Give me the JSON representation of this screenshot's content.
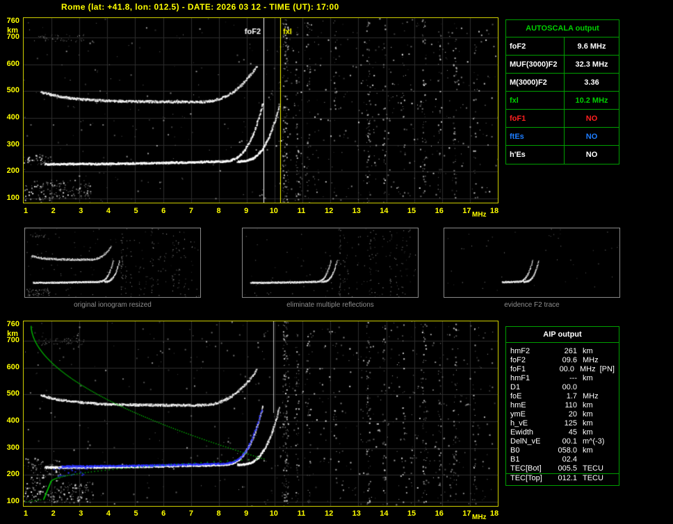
{
  "header": {
    "title": "Rome (lat: +41.8, lon: 012.5) - DATE: 2026 03 12 - TIME (UT): 17:00"
  },
  "axes": {
    "y_unit": "km",
    "x_unit": "MHz",
    "y_ticks": [
      760,
      700,
      600,
      500,
      400,
      300,
      200,
      100
    ],
    "x_ticks": [
      1,
      2,
      3,
      4,
      5,
      6,
      7,
      8,
      9,
      10,
      11,
      12,
      13,
      14,
      15,
      16,
      17,
      18
    ]
  },
  "top_plot": {
    "markers": {
      "foF2": {
        "label": "foF2",
        "freq_mhz": 9.6,
        "color": "#ffffff"
      },
      "fxl": {
        "label": "fxl",
        "freq_mhz": 10.2,
        "color": "#ffff00"
      }
    }
  },
  "autoscala": {
    "title": "AUTOSCALA output",
    "rows": [
      {
        "label": "foF2",
        "value": "9.6 MHz",
        "color": "#ffffff"
      },
      {
        "label": "MUF(3000)F2",
        "value": "32.3 MHz",
        "color": "#ffffff"
      },
      {
        "label": "M(3000)F2",
        "value": "3.36",
        "color": "#ffffff"
      },
      {
        "label": "fxl",
        "value": "10.2 MHz",
        "color": "#00d000"
      },
      {
        "label": "foF1",
        "value": "NO",
        "color": "#ff2020"
      },
      {
        "label": "ftEs",
        "value": "NO",
        "color": "#1e7dff"
      },
      {
        "label": "h'Es",
        "value": "NO",
        "color": "#ffffff"
      }
    ]
  },
  "thumbnails": [
    {
      "caption": "original ionogram resized"
    },
    {
      "caption": "eliminate multiple reflections"
    },
    {
      "caption": "evidence F2 trace"
    }
  ],
  "aip": {
    "title": "AIP output",
    "rows": [
      {
        "label": "hmF2",
        "value": "261",
        "unit": "km"
      },
      {
        "label": "foF2",
        "value": "09.6",
        "unit": "MHz"
      },
      {
        "label": "foF1",
        "value": "00.0",
        "unit": "MHz",
        "extra": "[PN]"
      },
      {
        "label": "hmF1",
        "value": "---",
        "unit": "km"
      },
      {
        "label": "D1",
        "value": "00.0",
        "unit": ""
      },
      {
        "label": "foE",
        "value": "1.7",
        "unit": "MHz"
      },
      {
        "label": "hmE",
        "value": "110",
        "unit": "km"
      },
      {
        "label": "ymE",
        "value": "20",
        "unit": "km"
      },
      {
        "label": "h_vE",
        "value": "125",
        "unit": "km"
      },
      {
        "label": "Ewidth",
        "value": "45",
        "unit": "km"
      },
      {
        "label": "DelN_vE",
        "value": "00.1",
        "unit": "m^(-3)"
      },
      {
        "label": "B0",
        "value": "058.0",
        "unit": "km"
      },
      {
        "label": "B1",
        "value": "02.4",
        "unit": ""
      },
      {
        "label": "TEC[Bot]",
        "value": "005.5",
        "unit": "TECU",
        "separator": true
      },
      {
        "label": "TEC[Top]",
        "value": "012.1",
        "unit": "TECU"
      }
    ]
  },
  "colors": {
    "axis_yellow": "#ffff00",
    "plot_border": "#d0d000",
    "table_green": "#00a000",
    "profile_green": "#00c800",
    "fitted_blue": "#2830ff",
    "no_red": "#ff2020",
    "es_blue": "#1e7dff",
    "caption_gray": "#8f8f8f"
  }
}
